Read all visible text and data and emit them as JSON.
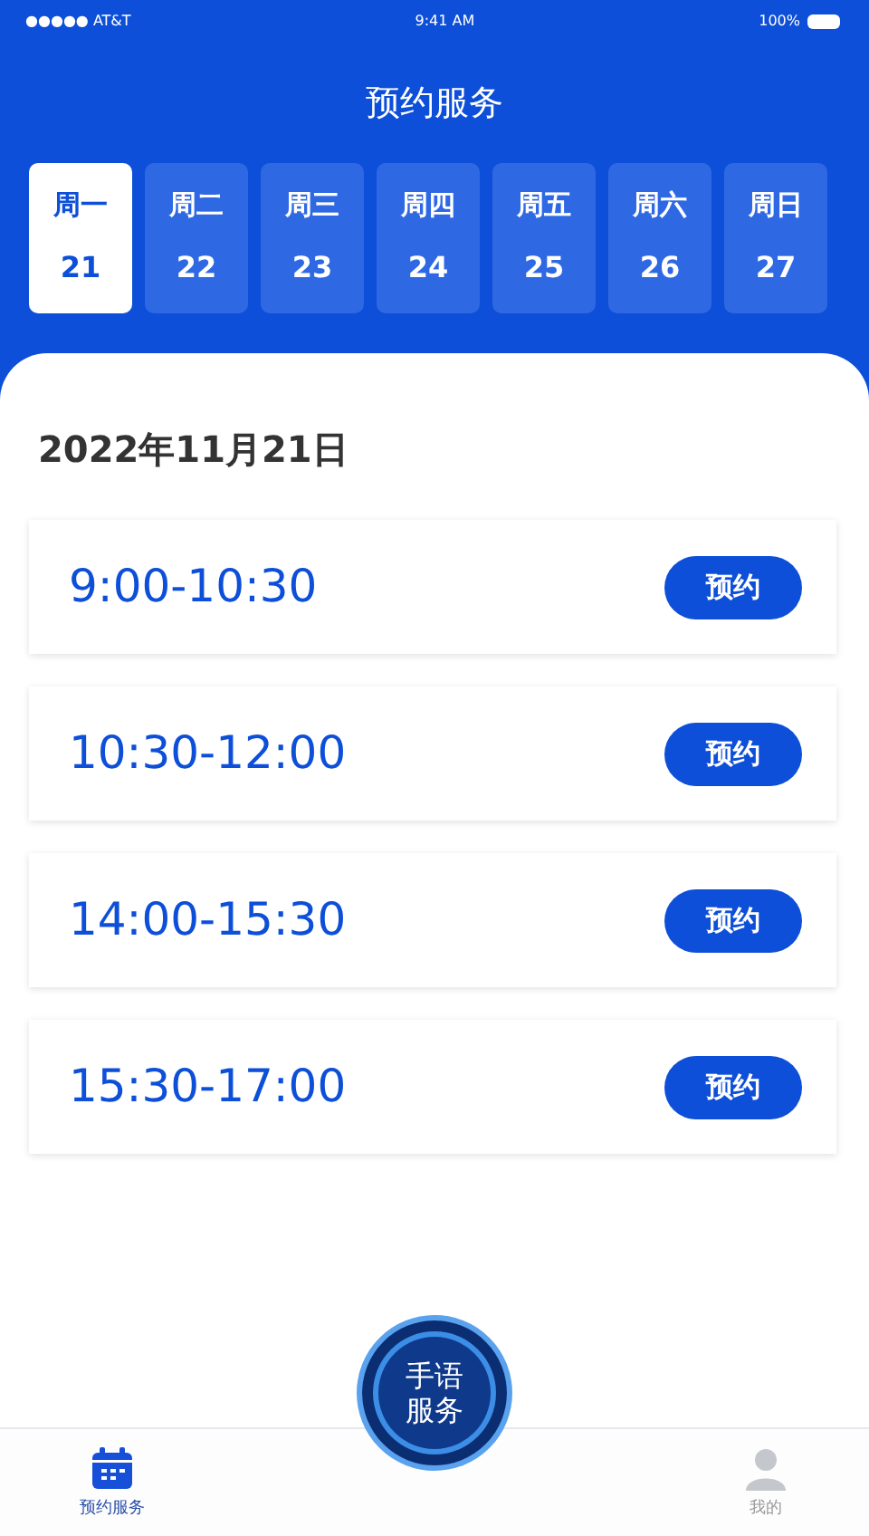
{
  "status_bar": {
    "carrier": "●●●●● AT&T",
    "time": "9:41 AM",
    "battery": "100%"
  },
  "title": "预约服务",
  "days": [
    {
      "weekday": "周一",
      "date": "21",
      "selected": true
    },
    {
      "weekday": "周二",
      "date": "22",
      "selected": false
    },
    {
      "weekday": "周三",
      "date": "23",
      "selected": false
    },
    {
      "weekday": "周四",
      "date": "24",
      "selected": false
    },
    {
      "weekday": "周五",
      "date": "25",
      "selected": false
    },
    {
      "weekday": "周六",
      "date": "26",
      "selected": false
    },
    {
      "weekday": "周日",
      "date": "27",
      "selected": false
    }
  ],
  "date_heading": "2022年11月21日",
  "slots": [
    {
      "time": "9:00-10:30",
      "button": "预约"
    },
    {
      "time": "10:30-12:00",
      "button": "预约"
    },
    {
      "time": "14:00-15:30",
      "button": "预约"
    },
    {
      "time": "15:30-17:00",
      "button": "预约"
    }
  ],
  "center_badge": {
    "line_1": "手语",
    "line_2": "服务"
  },
  "tab_bar": [
    {
      "label": "预约服务",
      "selected": true
    },
    {
      "label": "我的",
      "selected": false
    }
  ]
}
